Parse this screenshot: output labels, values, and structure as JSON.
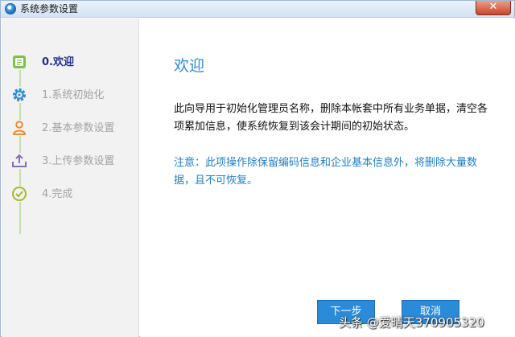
{
  "window": {
    "title": "系统参数设置"
  },
  "steps": [
    {
      "label": "0.欢迎",
      "icon": "document-icon",
      "active": true
    },
    {
      "label": "1.系统初始化",
      "icon": "gear-icon",
      "active": false
    },
    {
      "label": "2.基本参数设置",
      "icon": "user-icon",
      "active": false
    },
    {
      "label": "3.上传参数设置",
      "icon": "upload-tray-icon",
      "active": false
    },
    {
      "label": "4.完成",
      "icon": "check-circle-icon",
      "active": false
    }
  ],
  "main": {
    "heading": "欢迎",
    "paragraph": "此向导用于初始化管理员名称，删除本帐套中所有业务单据，清空各项累加信息，使系统恢复到该会计期间的初始状态。",
    "notice": "注意：此项操作除保留编码信息和企业基本信息外，将删除大量数据，且不可恢复。"
  },
  "buttons": {
    "next": "下一步",
    "cancel": "取消"
  },
  "watermark": "头条 @爱晴天370905320",
  "colors": {
    "accent": "#2f8ed6",
    "button": "#2b8bd8",
    "active_step": "#1f2e8c",
    "notice": "#1f7fc4",
    "step_line": "#c3e0a8"
  }
}
